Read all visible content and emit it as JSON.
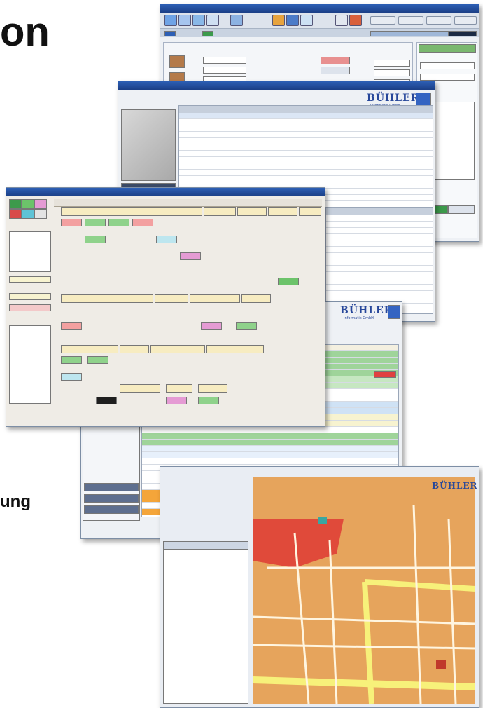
{
  "headline_top": "on",
  "headline_bottom": "ung",
  "brand_name": "BÜHLER",
  "brand_sub": "Informatik GmbH",
  "colors": {
    "titlebar": "#2d5fb5",
    "green_row": "#9fd49a",
    "orange_row": "#f4a53a",
    "map_block": "#e6a45c",
    "map_road": "#f7f17a",
    "accent_red": "#e04040"
  }
}
